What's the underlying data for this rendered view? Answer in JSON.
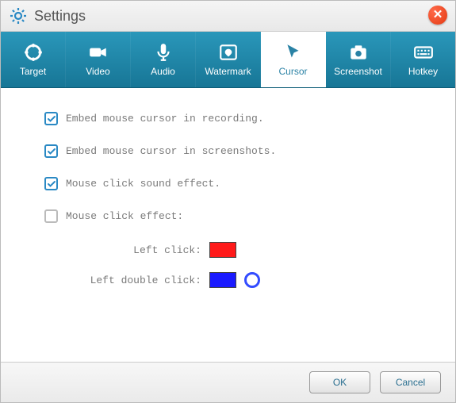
{
  "title": "Settings",
  "tabs": {
    "target": {
      "label": "Target"
    },
    "video": {
      "label": "Video"
    },
    "audio": {
      "label": "Audio"
    },
    "watermark": {
      "label": "Watermark"
    },
    "cursor": {
      "label": "Cursor",
      "active": true
    },
    "screenshot": {
      "label": "Screenshot"
    },
    "hotkey": {
      "label": "Hotkey"
    }
  },
  "options": {
    "embed_recording": {
      "label": "Embed mouse cursor in recording.",
      "checked": true
    },
    "embed_screenshots": {
      "label": "Embed mouse cursor in screenshots.",
      "checked": true
    },
    "click_sound": {
      "label": "Mouse click sound effect.",
      "checked": true
    },
    "click_effect": {
      "label": "Mouse click effect:",
      "checked": false
    }
  },
  "click_colors": {
    "left": {
      "label": "Left click:",
      "color": "#ff1a1a"
    },
    "left_double": {
      "label": "Left double click:",
      "color": "#1a1aff"
    }
  },
  "footer": {
    "ok": "OK",
    "cancel": "Cancel"
  }
}
